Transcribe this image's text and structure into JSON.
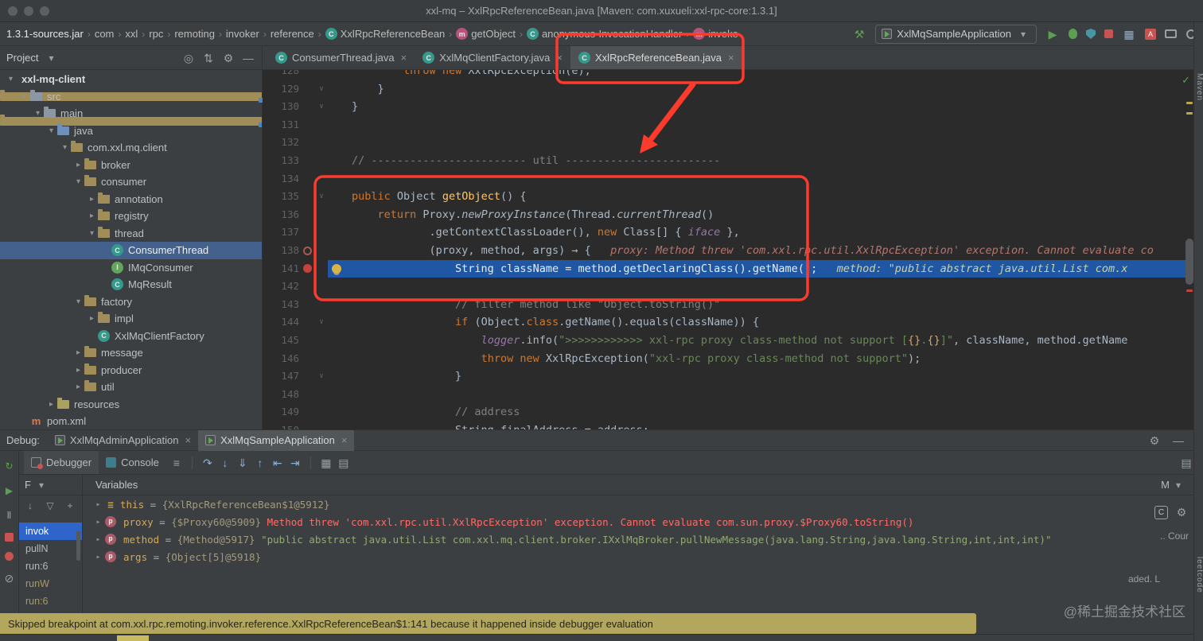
{
  "colors": {
    "annotation_red": "#fc3b2d",
    "exec_line_blue": "#2057a4",
    "tree_selection_blue": "#44608c",
    "frame_selected_blue": "#2f65ca",
    "banner_bg": "#b3a75e",
    "error_red": "#ff6b68"
  },
  "icons": {
    "crumb_sep": "›",
    "chevron_down": "▾",
    "chevron_right": "▸",
    "close": "×",
    "gear": "⚙",
    "minus": "—",
    "hamburger": "≡",
    "plus": "+",
    "arrow_down": "↓",
    "funnel": "▽",
    "target": "◎",
    "collapse": "⇅",
    "step_over": "↷",
    "step_into": "↓",
    "force_step_into": "⇓",
    "step_out": "↑",
    "drop_frame": "⇤",
    "run_to_cursor": "⇥",
    "grid": "▦",
    "layout": "▤",
    "rerun": "↻",
    "resume": "▶",
    "pause": "Ⅱ",
    "mute": "⊘",
    "check": "✓",
    "play": "▶",
    "hammer": "⚒",
    "fold_marker": "∨",
    "translate": "A"
  },
  "titlebar": {
    "title": "xxl-mq – XxlRpcReferenceBean.java [Maven: com.xuxueli:xxl-rpc-core:1.3.1]"
  },
  "navbar": {
    "crumbs": [
      {
        "label": "1.3.1-sources.jar",
        "strong": true
      },
      {
        "label": "com"
      },
      {
        "label": "xxl"
      },
      {
        "label": "rpc"
      },
      {
        "label": "remoting"
      },
      {
        "label": "invoker"
      },
      {
        "label": "reference"
      },
      {
        "label": "XxlRpcReferenceBean",
        "icon": "class"
      },
      {
        "label": "getObject",
        "icon": "method"
      },
      {
        "label": "anonymous-InvocationHandler",
        "icon": "class"
      },
      {
        "label": "invoke",
        "icon": "method"
      }
    ],
    "run_config": "XxlMqSampleApplication"
  },
  "project_panel": {
    "title": "Project",
    "tree": [
      {
        "label": "xxl-mq-client",
        "depth": 0,
        "chev": "v",
        "icon": "project",
        "bold": true
      },
      {
        "label": "src",
        "depth": 1,
        "chev": "v",
        "icon": "folder"
      },
      {
        "label": "main",
        "depth": 2,
        "chev": "v",
        "icon": "folder"
      },
      {
        "label": "java",
        "depth": 3,
        "chev": "v",
        "icon": "srcroot"
      },
      {
        "label": "com.xxl.mq.client",
        "depth": 4,
        "chev": "v",
        "icon": "package"
      },
      {
        "label": "broker",
        "depth": 5,
        "chev": "r",
        "icon": "package"
      },
      {
        "label": "consumer",
        "depth": 5,
        "chev": "v",
        "icon": "package"
      },
      {
        "label": "annotation",
        "depth": 6,
        "chev": "r",
        "icon": "package"
      },
      {
        "label": "registry",
        "depth": 6,
        "chev": "r",
        "icon": "package"
      },
      {
        "label": "thread",
        "depth": 6,
        "chev": "v",
        "icon": "package"
      },
      {
        "label": "ConsumerThread",
        "depth": 7,
        "chev": "",
        "icon": "class",
        "selected": true
      },
      {
        "label": "IMqConsumer",
        "depth": 7,
        "chev": "",
        "icon": "interface"
      },
      {
        "label": "MqResult",
        "depth": 7,
        "chev": "",
        "icon": "class"
      },
      {
        "label": "factory",
        "depth": 5,
        "chev": "v",
        "icon": "package"
      },
      {
        "label": "impl",
        "depth": 6,
        "chev": "r",
        "icon": "package"
      },
      {
        "label": "XxlMqClientFactory",
        "depth": 6,
        "chev": "",
        "icon": "class"
      },
      {
        "label": "message",
        "depth": 5,
        "chev": "r",
        "icon": "package"
      },
      {
        "label": "producer",
        "depth": 5,
        "chev": "r",
        "icon": "package"
      },
      {
        "label": "util",
        "depth": 5,
        "chev": "r",
        "icon": "package"
      },
      {
        "label": "resources",
        "depth": 3,
        "chev": "r",
        "icon": "resroot"
      },
      {
        "label": "pom.xml",
        "depth": 1,
        "chev": "",
        "icon": "maven"
      }
    ]
  },
  "editor": {
    "tabs": [
      {
        "label": "ConsumerThread.java",
        "active": false
      },
      {
        "label": "XxlMqClientFactory.java",
        "active": false
      },
      {
        "label": "XxlRpcReferenceBean.java",
        "active": true
      }
    ],
    "lines": [
      {
        "n": "128",
        "ind": 8,
        "segs": [
          [
            "k",
            "throw "
          ],
          [
            "k",
            "new "
          ],
          [
            "d",
            "XxlRpcException(e);"
          ]
        ]
      },
      {
        "n": "129",
        "ind": 4,
        "fold": true,
        "segs": [
          [
            "d",
            "}"
          ]
        ]
      },
      {
        "n": "130",
        "ind": 0,
        "fold": true,
        "segs": [
          [
            "d",
            "}"
          ]
        ]
      },
      {
        "n": "131",
        "segs": []
      },
      {
        "n": "132",
        "segs": []
      },
      {
        "n": "133",
        "ind": 0,
        "segs": [
          [
            "c",
            "// ------------------------ util ------------------------"
          ]
        ]
      },
      {
        "n": "134",
        "segs": []
      },
      {
        "n": "135",
        "ind": 0,
        "fold": true,
        "segs": [
          [
            "k",
            "public "
          ],
          [
            "d",
            "Object "
          ],
          [
            "m",
            "getObject"
          ],
          [
            "d",
            "() {"
          ]
        ]
      },
      {
        "n": "136",
        "ind": 4,
        "segs": [
          [
            "k",
            "return "
          ],
          [
            "d",
            "Proxy."
          ],
          [
            "i",
            "newProxyInstance"
          ],
          [
            "d",
            "(Thread."
          ],
          [
            "i",
            "currentThread"
          ],
          [
            "d",
            "()"
          ]
        ]
      },
      {
        "n": "137",
        "ind": 12,
        "segs": [
          [
            "d",
            ".getContextClassLoader(), "
          ],
          [
            "k",
            "new "
          ],
          [
            "d",
            "Class[] { "
          ],
          [
            "f",
            "iface"
          ],
          [
            "d",
            " },"
          ]
        ]
      },
      {
        "n": "138",
        "ind": 12,
        "gutter": "ring",
        "segs": [
          [
            "d",
            "(proxy, method, args) → {"
          ]
        ],
        "hint": {
          "type": "err",
          "text": "proxy: Method threw 'com.xxl.rpc.util.XxlRpcException' exception. Cannot evaluate co"
        }
      },
      {
        "n": "141",
        "ind": 16,
        "hl": true,
        "gutter": "dot",
        "bulb": true,
        "segs": [
          [
            "d",
            "String className = method.getDeclaringClass().getName();"
          ]
        ],
        "hint": {
          "type": "val",
          "text": "method: \"public abstract java.util.List com.x"
        }
      },
      {
        "n": "142",
        "segs": []
      },
      {
        "n": "143",
        "ind": 16,
        "segs": [
          [
            "c",
            "// filter method like \"Object.toString()\""
          ]
        ]
      },
      {
        "n": "144",
        "ind": 16,
        "fold": true,
        "segs": [
          [
            "k",
            "if "
          ],
          [
            "d",
            "(Object."
          ],
          [
            "k",
            "class"
          ],
          [
            "d",
            ".getName().equals(className)) {"
          ]
        ]
      },
      {
        "n": "145",
        "ind": 20,
        "segs": [
          [
            "f",
            "logger"
          ],
          [
            "d",
            ".info("
          ],
          [
            "s",
            "\">>>>>>>>>>>> xxl-rpc proxy class-method not support ["
          ],
          [
            "sh",
            "{}"
          ],
          [
            "s",
            "."
          ],
          [
            "sh",
            "{}"
          ],
          [
            "s",
            "]\""
          ],
          [
            "d",
            ", className, method.getName"
          ]
        ]
      },
      {
        "n": "146",
        "ind": 20,
        "segs": [
          [
            "k",
            "throw "
          ],
          [
            "k",
            "new "
          ],
          [
            "d",
            "XxlRpcException("
          ],
          [
            "s",
            "\"xxl-rpc proxy class-method not support\""
          ],
          [
            "d",
            ");"
          ]
        ]
      },
      {
        "n": "147",
        "ind": 16,
        "fold": true,
        "segs": [
          [
            "d",
            "}"
          ]
        ]
      },
      {
        "n": "148",
        "segs": []
      },
      {
        "n": "149",
        "ind": 16,
        "segs": [
          [
            "c",
            "// address"
          ]
        ]
      },
      {
        "n": "150",
        "ind": 16,
        "segs": [
          [
            "d",
            "String finalAddress = address;"
          ]
        ]
      }
    ]
  },
  "debug": {
    "label": "Debug:",
    "session_tabs": [
      {
        "label": "XxlMqAdminApplication",
        "active": false
      },
      {
        "label": "XxlMqSampleApplication",
        "active": true
      }
    ],
    "view_tabs": [
      {
        "label": "Debugger"
      },
      {
        "label": "Console"
      }
    ],
    "threads_combo": "F",
    "variables_title": "Variables",
    "memory_label": "M",
    "c_button": "C",
    "frames": [
      {
        "label": "invok",
        "selected": true,
        "muted": false
      },
      {
        "label": "pullN",
        "selected": false,
        "muted": false
      },
      {
        "label": "run:6",
        "selected": false,
        "muted": false
      },
      {
        "label": "runW",
        "selected": false,
        "muted": true
      },
      {
        "label": "run:6",
        "selected": false,
        "muted": true
      }
    ],
    "variables": [
      {
        "name": "this",
        "ref": "{XxlRpcReferenceBean$1@5912}",
        "error": "",
        "str": ""
      },
      {
        "name": "proxy",
        "ref": "{$Proxy60@5909}",
        "error": " Method threw 'com.xxl.rpc.util.XxlRpcException' exception. Cannot evaluate com.sun.proxy.$Proxy60.toString()",
        "str": ""
      },
      {
        "name": "method",
        "ref": "{Method@5917}",
        "error": "",
        "str": " \"public abstract java.util.List com.xxl.mq.client.broker.IXxlMqBroker.pullNewMessage(java.lang.String,java.lang.String,int,int,int)\""
      },
      {
        "name": "args",
        "ref": "{Object[5]@5918}",
        "error": "",
        "str": ""
      }
    ],
    "fragments": {
      "cour": ".. Cour",
      "loaded": "aded. L"
    }
  },
  "banner": {
    "text": "Skipped breakpoint at com.xxl.rpc.remoting.invoker.reference.XxlRpcReferenceBean$1:141 because it happened inside debugger evaluation"
  },
  "watermark": "@稀土掘金技术社区",
  "right_stripe": {
    "top_label": "Maven",
    "bottom_label": "leetcode"
  }
}
